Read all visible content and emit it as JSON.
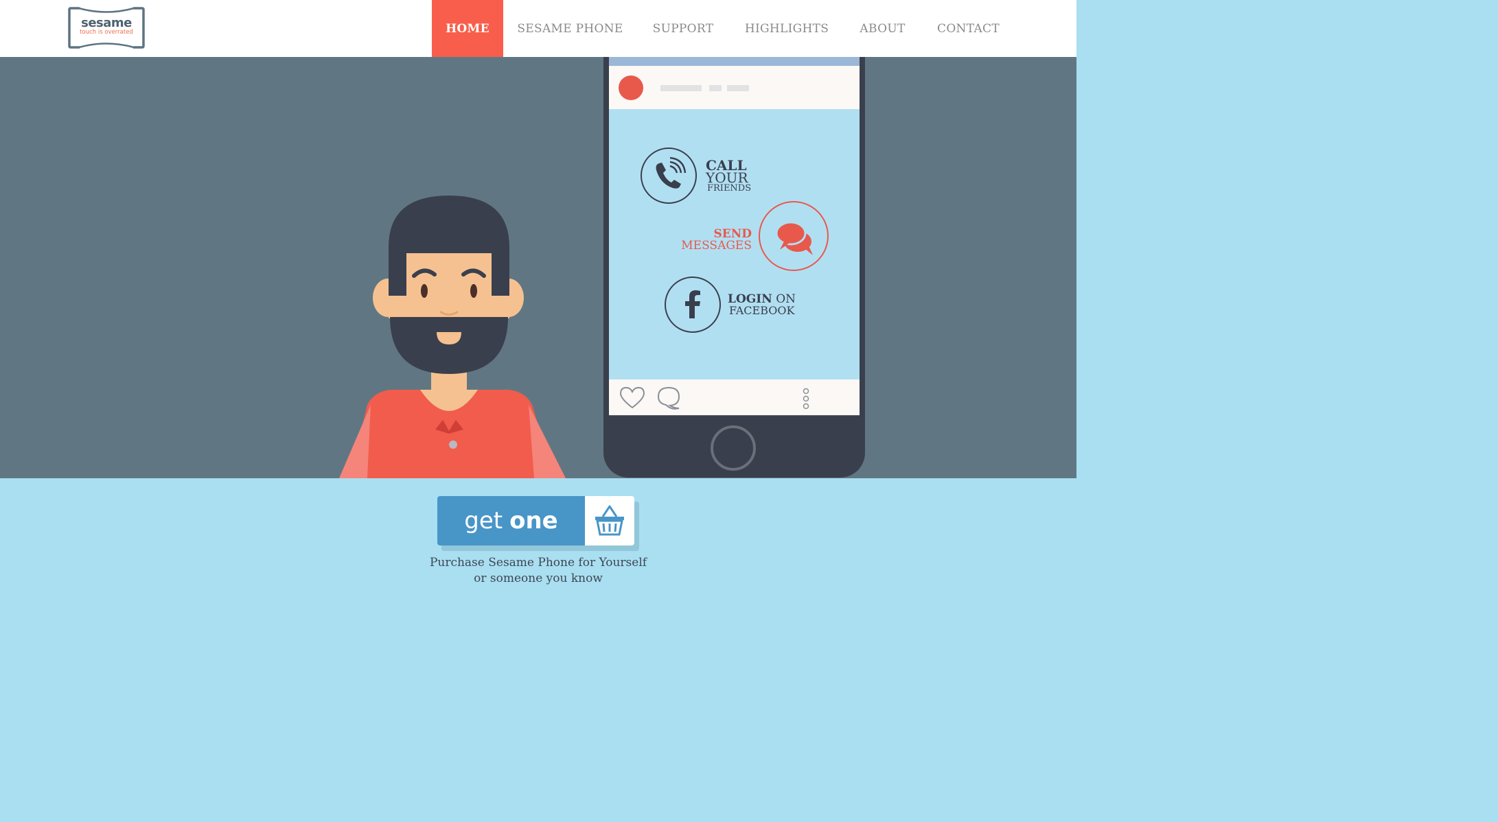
{
  "logo": {
    "name": "sesame",
    "tagline": "touch is overrated"
  },
  "nav": [
    {
      "label": "HOME",
      "active": true
    },
    {
      "label": "SESAME PHONE"
    },
    {
      "label": "SUPPORT"
    },
    {
      "label": "HIGHLIGHTS"
    },
    {
      "label": "ABOUT"
    },
    {
      "label": "CONTACT"
    }
  ],
  "phone": {
    "call": {
      "line1": "CALL",
      "line2": "YOUR",
      "line3": "FRIENDS",
      "icon": "phone-icon"
    },
    "send": {
      "line1": "SEND",
      "line2": "MESSAGES",
      "icon": "chat-bubbles-icon"
    },
    "login": {
      "bold": "LOGIN",
      "rest": "ON",
      "line2": "FACEBOOK",
      "icon": "facebook-icon"
    },
    "footer_icons": [
      "heart-icon",
      "comment-icon",
      "more-vertical-icon"
    ]
  },
  "cta": {
    "button_pre": "get",
    "button_bold": "one",
    "basket_icon": "basket-icon",
    "line1": "Purchase Sesame Phone for Yourself",
    "line2": "or someone you know"
  },
  "colors": {
    "accent": "#f85e4b",
    "hero_bg": "#607783",
    "cta_bg": "#a9dff0",
    "button": "#4895c8",
    "phone_screen": "#b1dff2",
    "dark": "#3a3f4d"
  }
}
